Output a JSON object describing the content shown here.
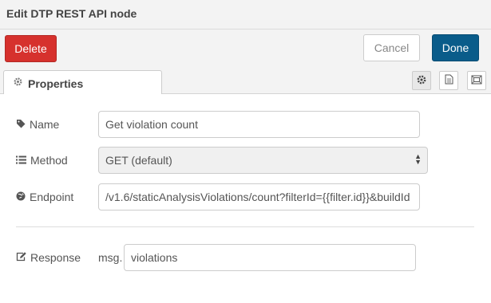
{
  "dialog": {
    "title": "Edit DTP REST API node"
  },
  "toolbar": {
    "delete_label": "Delete",
    "cancel_label": "Cancel",
    "done_label": "Done"
  },
  "tabs": [
    {
      "label": "Properties",
      "icon": "gear-icon"
    }
  ],
  "tab_buttons": [
    "gear-icon",
    "document-icon",
    "frame-icon"
  ],
  "form": {
    "name": {
      "label": "Name",
      "icon": "tag-icon",
      "value": "Get violation count"
    },
    "method": {
      "label": "Method",
      "icon": "list-icon",
      "value": "GET (default)"
    },
    "endpoint": {
      "label": "Endpoint",
      "icon": "globe-icon",
      "value": "/v1.6/staticAnalysisViolations/count?filterId={{filter.id}}&buildId"
    },
    "response": {
      "label": "Response",
      "icon": "edit-icon",
      "prefix": "msg.",
      "value": "violations"
    }
  },
  "colors": {
    "delete": "#d6312d",
    "done": "#0a5c8a"
  }
}
